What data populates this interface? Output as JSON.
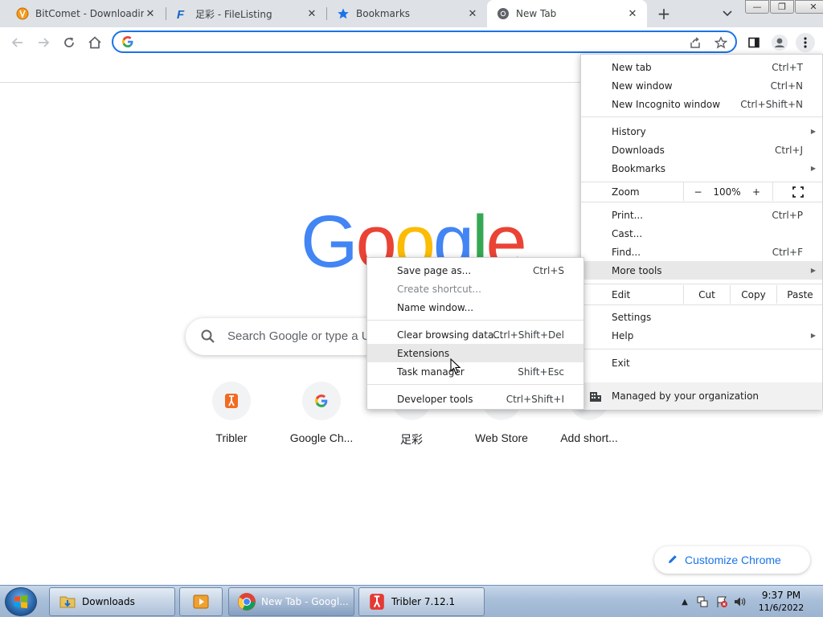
{
  "tabs": [
    {
      "title": "BitComet - Downloading",
      "close": "✕"
    },
    {
      "title": "足彩 - FileListing",
      "close": "✕"
    },
    {
      "title": "Bookmarks",
      "close": "✕"
    },
    {
      "title": "New Tab",
      "close": "✕"
    }
  ],
  "tabstrip": {
    "new_tab": "+"
  },
  "window_controls": {
    "minimize": "—",
    "maximize": "❐",
    "close": "✕"
  },
  "omnibox": {
    "value": "",
    "placeholder": ""
  },
  "content": {
    "logo_letters": [
      "G",
      "o",
      "o",
      "g",
      "l",
      "e"
    ],
    "search_placeholder": "Search Google or type a URL",
    "shortcuts": [
      "Tribler",
      "Google Ch...",
      "足彩",
      "Web Store",
      "Add short..."
    ],
    "customize": "Customize Chrome"
  },
  "menu": {
    "new_tab": {
      "label": "New tab",
      "shortcut": "Ctrl+T"
    },
    "new_window": {
      "label": "New window",
      "shortcut": "Ctrl+N"
    },
    "new_incognito": {
      "label": "New Incognito window",
      "shortcut": "Ctrl+Shift+N"
    },
    "history": {
      "label": "History"
    },
    "downloads": {
      "label": "Downloads",
      "shortcut": "Ctrl+J"
    },
    "bookmarks": {
      "label": "Bookmarks"
    },
    "zoom": {
      "label": "Zoom",
      "minus": "−",
      "value": "100%",
      "plus": "+"
    },
    "print": {
      "label": "Print...",
      "shortcut": "Ctrl+P"
    },
    "cast": {
      "label": "Cast..."
    },
    "find": {
      "label": "Find...",
      "shortcut": "Ctrl+F"
    },
    "more_tools": {
      "label": "More tools"
    },
    "edit": {
      "label": "Edit",
      "cut": "Cut",
      "copy": "Copy",
      "paste": "Paste"
    },
    "settings": {
      "label": "Settings"
    },
    "help": {
      "label": "Help"
    },
    "exit": {
      "label": "Exit"
    },
    "managed": {
      "label": "Managed by your organization"
    }
  },
  "submenu": {
    "save_page": {
      "label": "Save page as...",
      "shortcut": "Ctrl+S"
    },
    "create_shortcut": {
      "label": "Create shortcut..."
    },
    "name_window": {
      "label": "Name window..."
    },
    "clear_data": {
      "label": "Clear browsing data...",
      "shortcut": "Ctrl+Shift+Del"
    },
    "extensions": {
      "label": "Extensions"
    },
    "task_manager": {
      "label": "Task manager",
      "shortcut": "Shift+Esc"
    },
    "dev_tools": {
      "label": "Developer tools",
      "shortcut": "Ctrl+Shift+I"
    }
  },
  "taskbar": {
    "tasks": [
      "Downloads",
      "New Tab - Googl...",
      "Tribler 7.12.1"
    ],
    "time": "9:37 PM",
    "date": "11/6/2022",
    "tray_arrow": "▲"
  },
  "colors": {
    "accent": "#1a73e8",
    "google_blue": "#4285f4",
    "google_red": "#ea4335",
    "google_yellow": "#fbbc05",
    "google_green": "#34a853"
  }
}
